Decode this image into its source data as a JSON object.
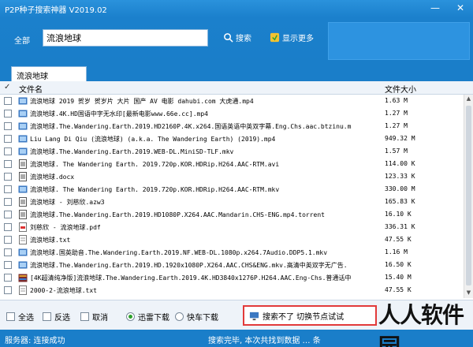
{
  "window": {
    "title": "P2P种子搜索神器 V2019.02",
    "minimize": "—",
    "close": "✕"
  },
  "search": {
    "label": "全部",
    "value": "流浪地球",
    "search_button": "搜索",
    "more_button": "显示更多"
  },
  "tab": {
    "label": "流浪地球"
  },
  "header": {
    "check": "✓",
    "name": "文件名",
    "size": "文件大小"
  },
  "files": [
    {
      "name": "流浪地球 2019 贺岁 贺岁片 大片 国产 AV 电影 dahubi.com 大虎通.mp4",
      "size": "1.63 M",
      "icon": "video-icon"
    },
    {
      "name": "流浪地球.4K.HD国语中字无水印[最新电影www.66e.cc].mp4",
      "size": "1.27 M",
      "icon": "video-icon"
    },
    {
      "name": "流浪地球.The.Wandering.Earth.2019.HD2160P.4K.x264.国语英语中英双字幕.Eng.Chs.aac.btzinu.m",
      "size": "1.27 M",
      "icon": "video-icon"
    },
    {
      "name": "Liu Lang Di Qiu (流浪地球) (a.k.a. The Wandering Earth) (2019).mp4",
      "size": "949.32 M",
      "icon": "video-icon"
    },
    {
      "name": "流浪地球.The.Wandering.Earth.2019.WEB-DL.MiniSD-TLF.mkv",
      "size": "1.57 M",
      "icon": "video-icon"
    },
    {
      "name": " 流浪地球. The Wandering Earth. 2019.720p.KOR.HDRip.H264.AAC-RTM.avi",
      "size": "114.00 K",
      "icon": "doc-icon"
    },
    {
      "name": "流浪地球.docx",
      "size": "123.33 K",
      "icon": "doc-icon"
    },
    {
      "name": " 流浪地球. The Wandering Earth. 2019.720p.KOR.HDRip.H264.AAC-RTM.mkv",
      "size": "330.00 M",
      "icon": "video-icon"
    },
    {
      "name": "流浪地球 - 刘慈欣.azw3",
      "size": "165.83 K",
      "icon": "doc-icon"
    },
    {
      "name": "流浪地球.The.Wandering.Earth.2019.HD1080P.X264.AAC.Mandarin.CHS-ENG.mp4.torrent",
      "size": "16.10 K",
      "icon": "doc-icon"
    },
    {
      "name": "刘慈欣 - 流浪地球.pdf",
      "size": "336.31 K",
      "icon": "pdf-icon"
    },
    {
      "name": "流浪地球.txt",
      "size": "47.55 K",
      "icon": "text-icon"
    },
    {
      "name": "流浪地球.国英助音.The.Wandering.Earth.2019.NF.WEB-DL.1080p.x264.7Audio.DDP5.1.mkv",
      "size": "1.16 M",
      "icon": "video-icon"
    },
    {
      "name": "流浪地球.The.Wandering.Earth.2019.HD.1920x1080P.X264.AAC.CHS&ENG.mkv.高清中英双字无广告.",
      "size": "16.50 K",
      "icon": "video-icon"
    },
    {
      "name": "[4K超清纯净版]流浪地球.The.Wandering.Earth.2019.4K.HD3840x1276P.H264.AAC.Eng-Chs.普通话中",
      "size": "15.40 M",
      "icon": "archive-icon"
    },
    {
      "name": "2000-2-流浪地球.txt",
      "size": "47.55 K",
      "icon": "text-icon"
    }
  ],
  "bottom": {
    "select_all": "全选",
    "invert": "反选",
    "cancel": "取消",
    "xunlei": "迅雷下载",
    "bt": "快车下载",
    "action_button": "搜索不了 切换节点试试"
  },
  "status": {
    "left": "服务器: 连接成功",
    "right": "搜索完毕, 本次共找到数据 … 条"
  },
  "watermark": "人人软件园",
  "colors": {
    "brand_blue": "#1a7ec9",
    "highlight_red": "#e23a3a"
  }
}
